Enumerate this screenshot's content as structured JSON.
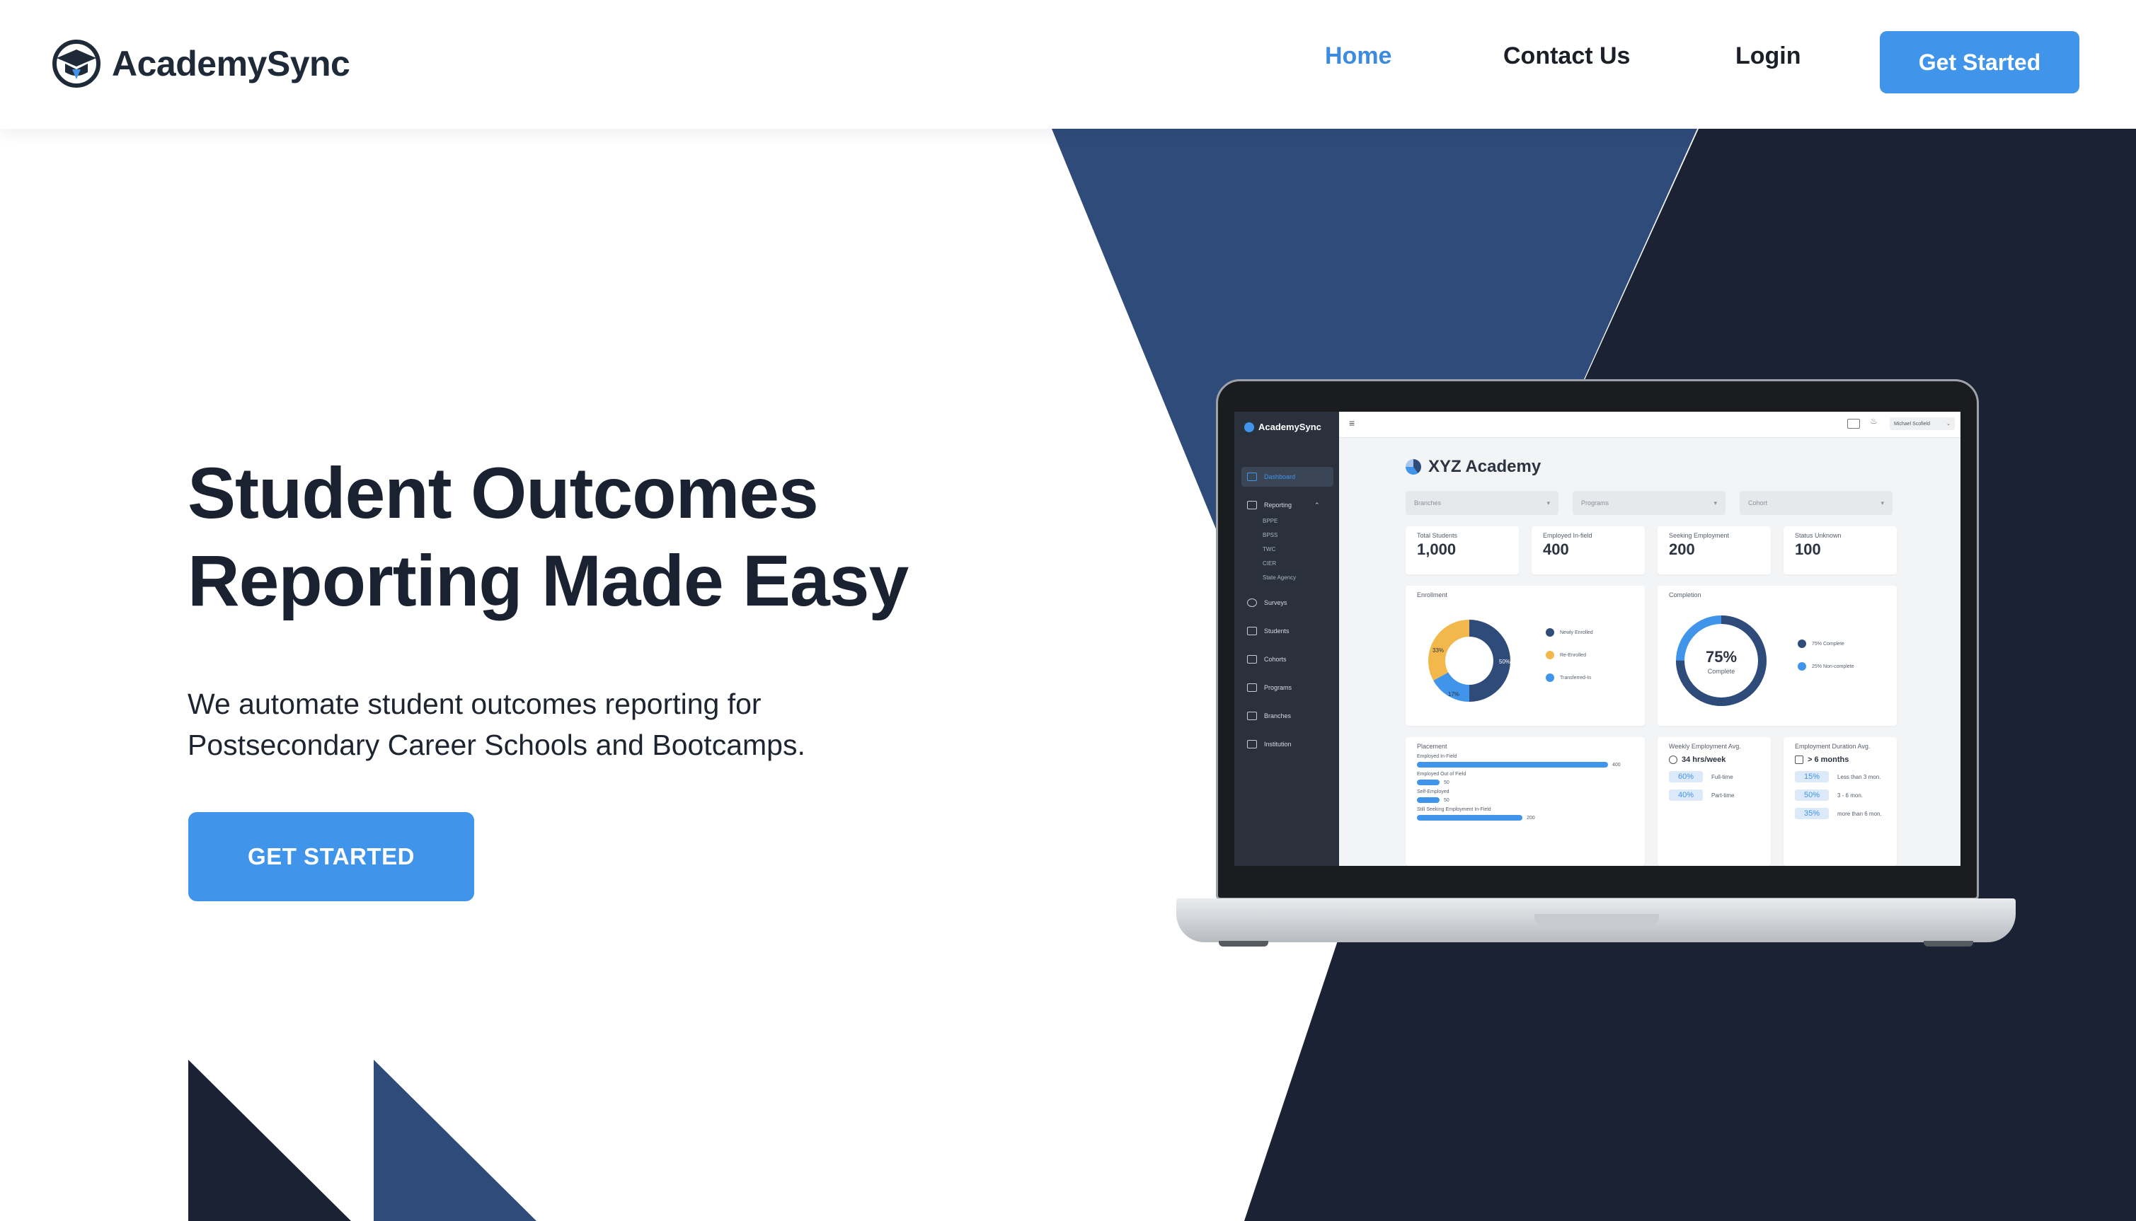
{
  "header": {
    "brand": "AcademySync",
    "nav": {
      "home": "Home",
      "contact": "Contact Us",
      "login": "Login"
    },
    "cta": "Get Started"
  },
  "hero": {
    "title_line1": "Student Outcomes",
    "title_line2": "Reporting Made Easy",
    "subtitle_line1": "We automate student outcomes reporting for",
    "subtitle_line2": "Postsecondary Career Schools and Bootcamps.",
    "cta": "GET STARTED"
  },
  "colors": {
    "accent": "#4095ea",
    "navy_dark": "#1b2233",
    "navy_mid": "#2f4b79",
    "text_dark": "#1a2130"
  },
  "dashboard": {
    "brand": "AcademySync",
    "user": "Michael Scofield",
    "title": "XYZ Academy",
    "sidebar": {
      "dashboard": "Dashboard",
      "reporting": "Reporting",
      "reporting_sub": [
        "BPPE",
        "BPSS",
        "TWC",
        "CIER",
        "State Agency"
      ],
      "surveys": "Surveys",
      "students": "Students",
      "cohorts": "Cohorts",
      "programs": "Programs",
      "branches": "Branches",
      "institution": "Institution"
    },
    "filters": {
      "branches": "Branches",
      "programs": "Programs",
      "cohort": "Cohort"
    },
    "stats": [
      {
        "label": "Total Students",
        "value": "1,000"
      },
      {
        "label": "Employed In-field",
        "value": "400"
      },
      {
        "label": "Seeking Employment",
        "value": "200"
      },
      {
        "label": "Status Unknown",
        "value": "100"
      }
    ],
    "enrollment": {
      "title": "Enrollment",
      "legend": [
        "Newly Enrolled",
        "Re-Enrolled",
        "Transferred-In"
      ],
      "labels": [
        "33%",
        "50%",
        "17%"
      ],
      "values": [
        50,
        33,
        17
      ]
    },
    "completion": {
      "title": "Completion",
      "center_value": "75%",
      "center_label": "Complete",
      "legend": [
        "75% Complete",
        "25% Non-complete"
      ],
      "value": 75
    },
    "placement": {
      "title": "Placement",
      "bars": [
        {
          "label": "Employed In-Field",
          "value": "400",
          "fraction": 1.0
        },
        {
          "label": "Employed Out of Field",
          "value": "50",
          "fraction": 0.12
        },
        {
          "label": "Self-Employed",
          "value": "50",
          "fraction": 0.12
        },
        {
          "label": "Still Seeking Employment In-Field",
          "value": "200",
          "fraction": 0.55
        }
      ]
    },
    "weekly": {
      "title": "Weekly Employment Avg.",
      "headline": "34 hrs/week",
      "rows": [
        {
          "pct": "60%",
          "label": "Full-time"
        },
        {
          "pct": "40%",
          "label": "Part-time"
        }
      ]
    },
    "duration": {
      "title": "Employment Duration Avg.",
      "headline": "> 6 months",
      "rows": [
        {
          "pct": "15%",
          "label": "Less than 3 mon."
        },
        {
          "pct": "50%",
          "label": "3 - 6 mon."
        },
        {
          "pct": "35%",
          "label": "more than 6 mon."
        }
      ]
    }
  }
}
